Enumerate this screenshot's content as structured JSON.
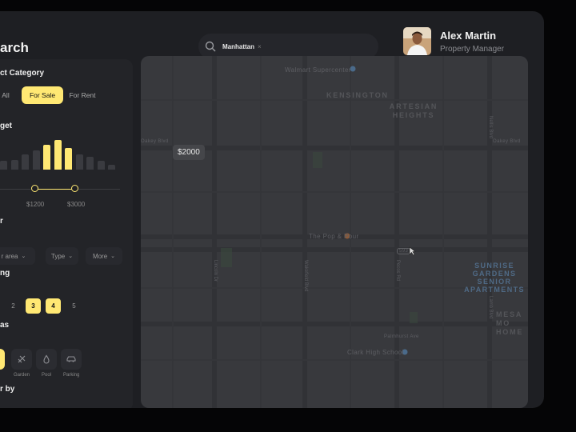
{
  "header": {
    "title": "arch",
    "search_chip": "Manhattan",
    "search_chip_close": "×",
    "user_name": "Alex Martin",
    "user_role": "Property Manager"
  },
  "sidebar": {
    "category_label": "ct Category",
    "category_options": [
      "All",
      "For Sale",
      "For Rent"
    ],
    "category_selected": "For Sale",
    "budget_label": "get",
    "budget_min": "$1200",
    "budget_max": "$3000",
    "budget_bars": [
      0.28,
      0.32,
      0.5,
      0.62,
      0.82,
      0.98,
      0.72,
      0.5,
      0.42,
      0.3,
      0.16
    ],
    "budget_active": [
      false,
      false,
      false,
      false,
      true,
      true,
      true,
      false,
      false,
      false,
      false
    ],
    "filter_label": "r",
    "filter_dropdowns": [
      "r area",
      "Type",
      "More"
    ],
    "rooms_label": "ng",
    "rooms_options": [
      "",
      "2",
      "3",
      "4",
      "5"
    ],
    "rooms_selected": [
      "3",
      "4"
    ],
    "amenities_label": "as",
    "amenities": [
      {
        "label": "r",
        "icon": "pool-icon",
        "active": true
      },
      {
        "label": "Garden",
        "icon": "garden-icon",
        "active": false
      },
      {
        "label": "Pool",
        "icon": "pool-drop-icon",
        "active": false
      },
      {
        "label": "Parking",
        "icon": "car-icon",
        "active": false
      }
    ],
    "sort_label": "r by"
  },
  "map": {
    "price_tag": "$2000",
    "places": {
      "walmart": "Walmart Supercenter",
      "kensington": "KENSINGTON",
      "artesian": "ARTESIAN HEIGHTS",
      "pour": "The Pop & Pour",
      "school": "Clark High School",
      "sunrise": "SUNRISE GARDENS SENIOR APARTMENTS",
      "mesa": "MESA MO HOME"
    },
    "streets": {
      "s1": "Oakey Blvd",
      "s2": "Oakey Blvd",
      "s3": "Palmhurst Ave",
      "v1": "Lincoln Dr",
      "v2": "Wakefield Blvd",
      "v3": "Pecos Rd",
      "v4": "Nellis Blvd",
      "v5": "Lamb Blvd"
    },
    "route_badge": "593"
  },
  "colors": {
    "accent": "#ffe873",
    "panel": "#232428",
    "map": "#38393d",
    "background": "#050506"
  }
}
